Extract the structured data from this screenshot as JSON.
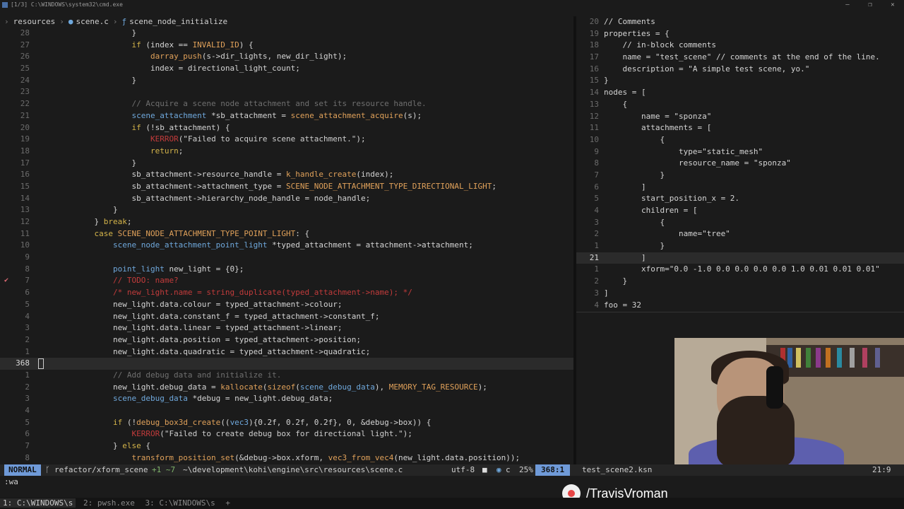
{
  "window": {
    "title": "[1/3] C:\\WINDOWS\\system32\\cmd.exe",
    "controls": [
      "—",
      "❐",
      "✕"
    ]
  },
  "breadcrumb": {
    "folder": "resources",
    "file": "scene.c",
    "symbol": "scene_node_initialize"
  },
  "left_code": [
    {
      "n": "28",
      "t": "                    }"
    },
    {
      "n": "27",
      "t": "                    if (index == INVALID_ID) {"
    },
    {
      "n": "26",
      "t": "                        darray_push(s->dir_lights, new_dir_light);"
    },
    {
      "n": "25",
      "t": "                        index = directional_light_count;"
    },
    {
      "n": "24",
      "t": "                    }"
    },
    {
      "n": "23",
      "t": ""
    },
    {
      "n": "22",
      "t": "                    // Acquire a scene node attachment and set its resource handle."
    },
    {
      "n": "21",
      "t": "                    scene_attachment *sb_attachment = scene_attachment_acquire(s);"
    },
    {
      "n": "20",
      "t": "                    if (!sb_attachment) {"
    },
    {
      "n": "19",
      "t": "                        KERROR(\"Failed to acquire scene attachment.\");"
    },
    {
      "n": "18",
      "t": "                        return;"
    },
    {
      "n": "17",
      "t": "                    }"
    },
    {
      "n": "16",
      "t": "                    sb_attachment->resource_handle = k_handle_create(index);"
    },
    {
      "n": "15",
      "t": "                    sb_attachment->attachment_type = SCENE_NODE_ATTACHMENT_TYPE_DIRECTIONAL_LIGHT;"
    },
    {
      "n": "14",
      "t": "                    sb_attachment->hierarchy_node_handle = node_handle;"
    },
    {
      "n": "13",
      "t": "                }"
    },
    {
      "n": "12",
      "t": "            } break;"
    },
    {
      "n": "11",
      "t": "            case SCENE_NODE_ATTACHMENT_TYPE_POINT_LIGHT: {"
    },
    {
      "n": "10",
      "t": "                scene_node_attachment_point_light *typed_attachment = attachment->attachment;"
    },
    {
      "n": "9",
      "t": ""
    },
    {
      "n": "8",
      "t": "                point_light new_light = {0};"
    },
    {
      "n": "7",
      "t": "                // TODO: name?",
      "sign": "✔"
    },
    {
      "n": "6",
      "t": "                /* new_light.name = string_duplicate(typed_attachment->name); */"
    },
    {
      "n": "5",
      "t": "                new_light.data.colour = typed_attachment->colour;"
    },
    {
      "n": "4",
      "t": "                new_light.data.constant_f = typed_attachment->constant_f;"
    },
    {
      "n": "3",
      "t": "                new_light.data.linear = typed_attachment->linear;"
    },
    {
      "n": "2",
      "t": "                new_light.data.position = typed_attachment->position;"
    },
    {
      "n": "1",
      "t": "                new_light.data.quadratic = typed_attachment->quadratic;"
    },
    {
      "n": "368",
      "t": "",
      "current": true
    },
    {
      "n": "1",
      "t": "                // Add debug data and initialize it."
    },
    {
      "n": "2",
      "t": "                new_light.debug_data = kallocate(sizeof(scene_debug_data), MEMORY_TAG_RESOURCE);"
    },
    {
      "n": "3",
      "t": "                scene_debug_data *debug = new_light.debug_data;"
    },
    {
      "n": "4",
      "t": ""
    },
    {
      "n": "5",
      "t": "                if (!debug_box3d_create((vec3){0.2f, 0.2f, 0.2f}, 0, &debug->box)) {"
    },
    {
      "n": "6",
      "t": "                    KERROR(\"Failed to create debug box for directional light.\");"
    },
    {
      "n": "7",
      "t": "                } else {"
    },
    {
      "n": "8",
      "t": "                    transform_position_set(&debug->box.xform, vec3_from_vec4(new_light.data.position));"
    }
  ],
  "right_code": [
    {
      "n": "20",
      "t": "// Comments"
    },
    {
      "n": "19",
      "t": "properties = {"
    },
    {
      "n": "18",
      "t": "    // in-block comments"
    },
    {
      "n": "17",
      "t": "    name = \"test_scene\" // comments at the end of the line."
    },
    {
      "n": "16",
      "t": "    description = \"A simple test scene, yo.\""
    },
    {
      "n": "15",
      "t": "}"
    },
    {
      "n": "14",
      "t": "nodes = ["
    },
    {
      "n": "13",
      "t": "    {"
    },
    {
      "n": "12",
      "t": "        name = \"sponza\""
    },
    {
      "n": "11",
      "t": "        attachments = ["
    },
    {
      "n": "10",
      "t": "            {"
    },
    {
      "n": "9",
      "t": "                type=\"static_mesh\""
    },
    {
      "n": "8",
      "t": "                resource_name = \"sponza\""
    },
    {
      "n": "7",
      "t": "            }"
    },
    {
      "n": "6",
      "t": "        ]"
    },
    {
      "n": "5",
      "t": "        start_position_x = 2."
    },
    {
      "n": "4",
      "t": "        children = ["
    },
    {
      "n": "3",
      "t": "            {"
    },
    {
      "n": "2",
      "t": "                name=\"tree\""
    },
    {
      "n": "1",
      "t": "            }"
    },
    {
      "n": "21",
      "t": "        ]",
      "current": true
    },
    {
      "n": "1",
      "t": "        xform=\"0.0 -1.0 0.0 0.0 0.0 0.0 1.0 0.01 0.01 0.01\""
    },
    {
      "n": "2",
      "t": "    }"
    },
    {
      "n": "3",
      "t": "]"
    },
    {
      "n": "4",
      "t": "foo = 32"
    }
  ],
  "status": {
    "mode": "NORMAL",
    "branch": "refactor/xform_scene",
    "diff": "+1 ~7",
    "path": "~\\development\\kohi\\engine\\src\\resources\\scene.c",
    "encoding": "utf-8",
    "filetype": "c",
    "percent": "25%",
    "position": "368:1",
    "right_file": "test_scene2.ksn",
    "right_position": "21:9"
  },
  "cmdline": ":wa",
  "tmux": {
    "tab1": "1: C:\\WINDOWS\\s",
    "tab2": "2: pwsh.exe",
    "tab3": "3: C:\\WINDOWS\\s",
    "add": "+"
  },
  "watermark": "/TravisVroman"
}
